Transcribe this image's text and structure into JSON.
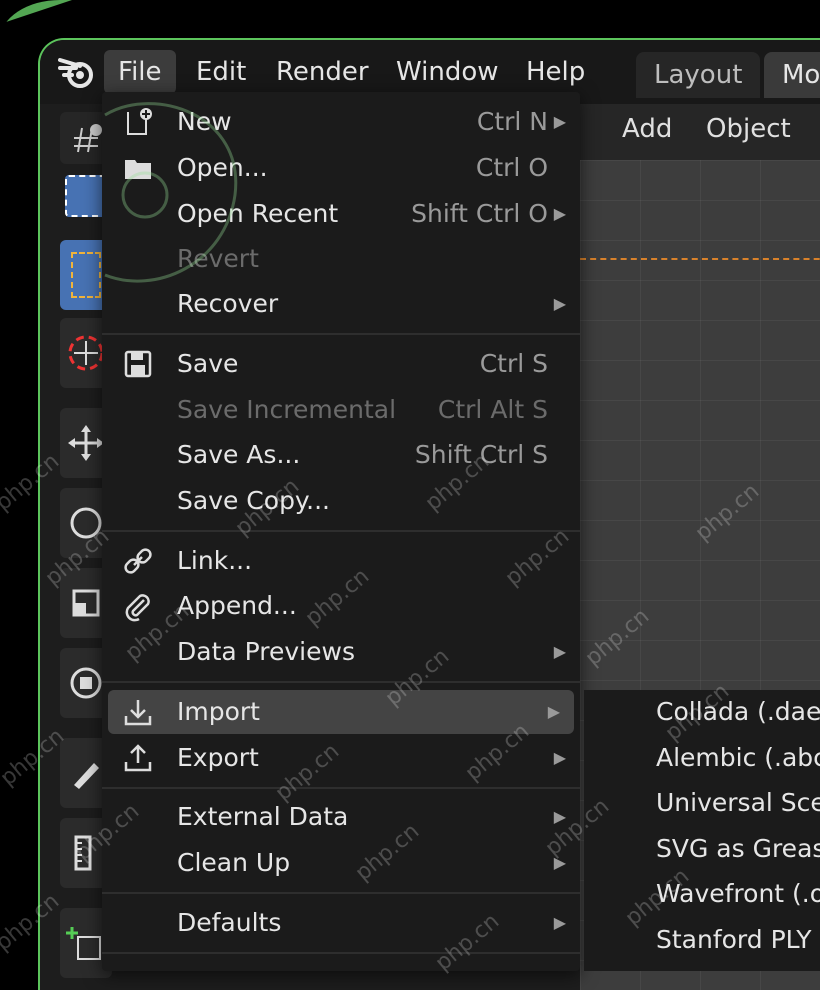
{
  "colors": {
    "accent": "#4772b3",
    "frame": "#5cc45c",
    "highlight": "#444444",
    "selection_outline": "#d9822b"
  },
  "menubar": {
    "items": [
      "File",
      "Edit",
      "Render",
      "Window",
      "Help"
    ],
    "active": "File"
  },
  "workspaces": {
    "tabs": [
      "Layout",
      "Mo"
    ]
  },
  "viewport_header": {
    "items": [
      "Add",
      "Object"
    ]
  },
  "file_menu": {
    "rows": [
      {
        "label": "New",
        "shortcut": "Ctrl N",
        "submenu": true,
        "icon": "new-file-icon"
      },
      {
        "label": "Open...",
        "shortcut": "Ctrl O",
        "icon": "folder-icon"
      },
      {
        "label": "Open Recent",
        "shortcut": "Shift Ctrl O",
        "submenu": true
      },
      {
        "label": "Revert",
        "disabled": true
      },
      {
        "label": "Recover",
        "submenu": true
      },
      {
        "label": "Save",
        "shortcut": "Ctrl S",
        "icon": "save-icon"
      },
      {
        "label": "Save Incremental",
        "shortcut": "Ctrl Alt S",
        "disabled": true
      },
      {
        "label": "Save As...",
        "shortcut": "Shift Ctrl S"
      },
      {
        "label": "Save Copy..."
      },
      {
        "label": "Link...",
        "icon": "link-icon"
      },
      {
        "label": "Append...",
        "icon": "paperclip-icon"
      },
      {
        "label": "Data Previews",
        "submenu": true
      },
      {
        "label": "Import",
        "submenu": true,
        "icon": "import-icon",
        "highlighted": true
      },
      {
        "label": "Export",
        "submenu": true,
        "icon": "export-icon"
      },
      {
        "label": "External Data",
        "submenu": true
      },
      {
        "label": "Clean Up",
        "submenu": true
      },
      {
        "label": "Defaults",
        "submenu": true
      }
    ]
  },
  "import_submenu": {
    "items": [
      "Collada (.dae)",
      "Alembic (.abc",
      "Universal Sce",
      "SVG as Grease",
      "Wavefront (.ol",
      "Stanford PLY"
    ]
  },
  "watermark": {
    "text": "php.cn"
  }
}
